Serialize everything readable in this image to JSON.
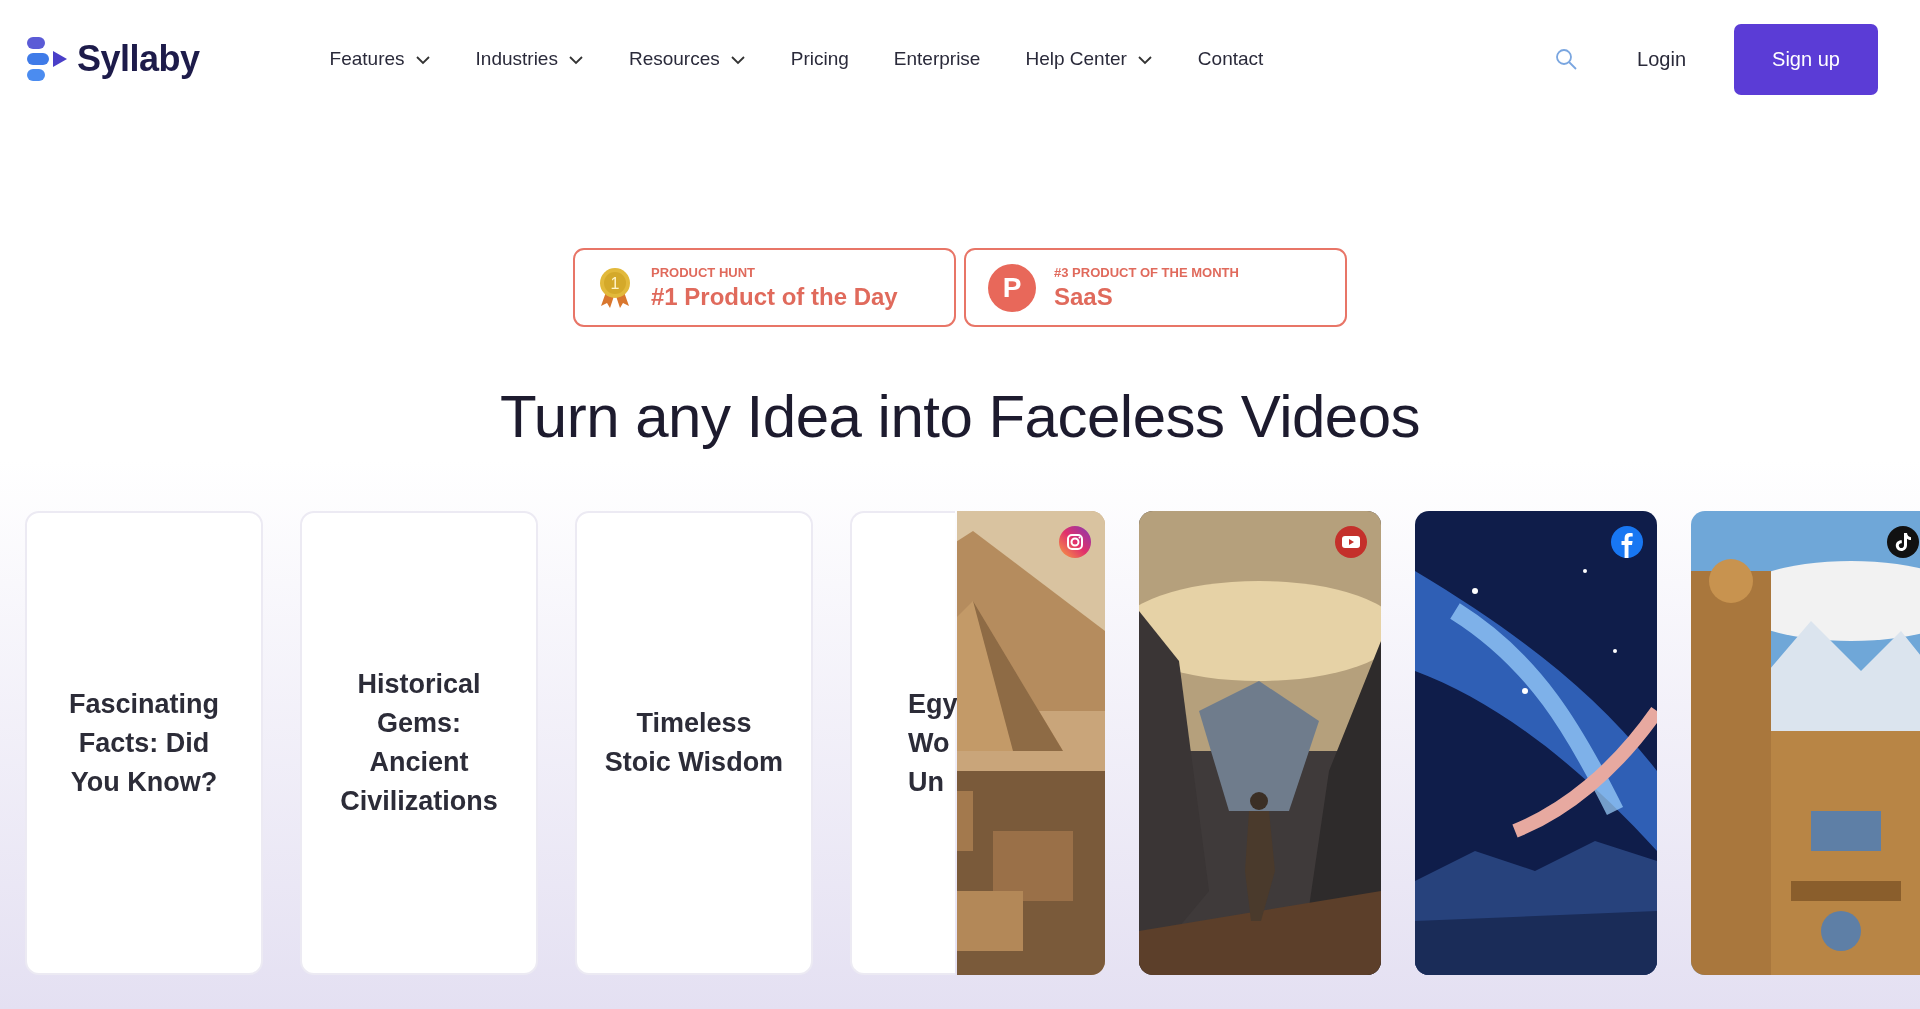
{
  "header": {
    "logo": {
      "text": "Syllaby"
    },
    "nav": [
      {
        "label": "Features",
        "dropdown": true
      },
      {
        "label": "Industries",
        "dropdown": true
      },
      {
        "label": "Resources",
        "dropdown": true
      },
      {
        "label": "Pricing",
        "dropdown": false
      },
      {
        "label": "Enterprise",
        "dropdown": false
      },
      {
        "label": "Help Center",
        "dropdown": true
      },
      {
        "label": "Contact",
        "dropdown": false
      }
    ],
    "login": "Login",
    "signup": "Sign up"
  },
  "badges": [
    {
      "kind": "medal",
      "icon_text": "1",
      "eyebrow": "PRODUCT HUNT",
      "title": "#1 Product of the Day"
    },
    {
      "kind": "logo",
      "icon_text": "P",
      "eyebrow": "#3 PRODUCT OF THE MONTH",
      "title": "SaaS"
    }
  ],
  "headline": "Turn any Idea into Faceless Videos",
  "topic_cards": [
    {
      "lines": [
        "Fascinating",
        "Facts: Did",
        "You Know?"
      ]
    },
    {
      "lines": [
        "Historical",
        "Gems:",
        "Ancient",
        "Civilizations"
      ]
    },
    {
      "lines": [
        "Timeless",
        "Stoic Wisdom"
      ]
    },
    {
      "lines": [
        "Egy",
        "Wo",
        "Un"
      ]
    }
  ],
  "video_cards": [
    {
      "kind": "instagram"
    },
    {
      "kind": "youtube"
    },
    {
      "kind": "facebook"
    },
    {
      "kind": "tiktok"
    }
  ]
}
